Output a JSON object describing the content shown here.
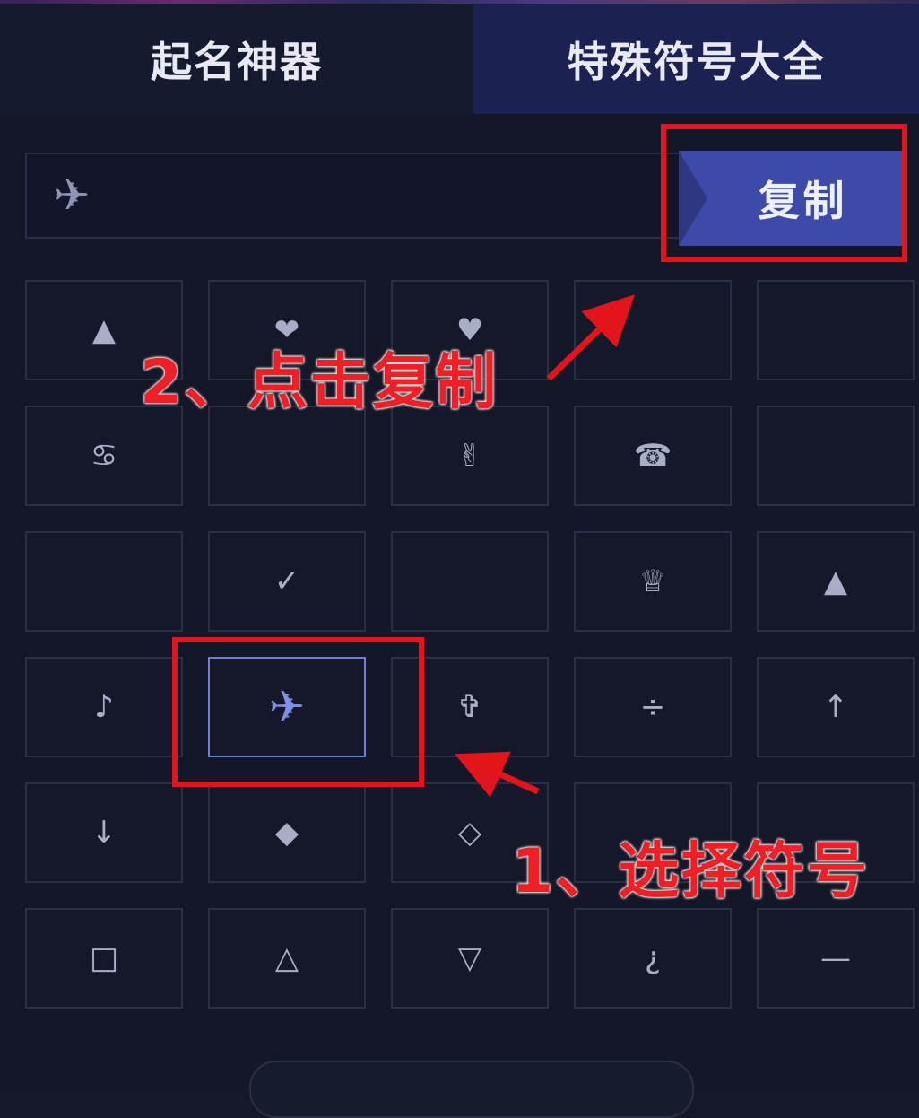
{
  "tabs": [
    {
      "label": "起名神器"
    },
    {
      "label": "特殊符号大全"
    }
  ],
  "input": {
    "value": "✈"
  },
  "copy_button": {
    "label": "复制"
  },
  "symbol_grid": {
    "rows": [
      [
        "▲",
        "❤",
        "♥",
        "",
        ""
      ],
      [
        "♋",
        "",
        "✌",
        "☎",
        ""
      ],
      [
        "",
        "✓",
        "",
        "♕",
        "▲"
      ],
      [
        "♪",
        "✈",
        "✞",
        "÷",
        "↑"
      ],
      [
        "↓",
        "◆",
        "◇",
        "",
        ""
      ],
      [
        "□",
        "△",
        "▽",
        "¿",
        "—"
      ]
    ],
    "selected": "✈"
  },
  "annotations": {
    "step1": "1、选择符号",
    "step2": "2、点击复制",
    "color": "#e3141b"
  },
  "colors": {
    "background": "#151829",
    "tab_active": "#1b2150",
    "button": "#3d4aa8",
    "selected_border": "#6d7fd6"
  }
}
